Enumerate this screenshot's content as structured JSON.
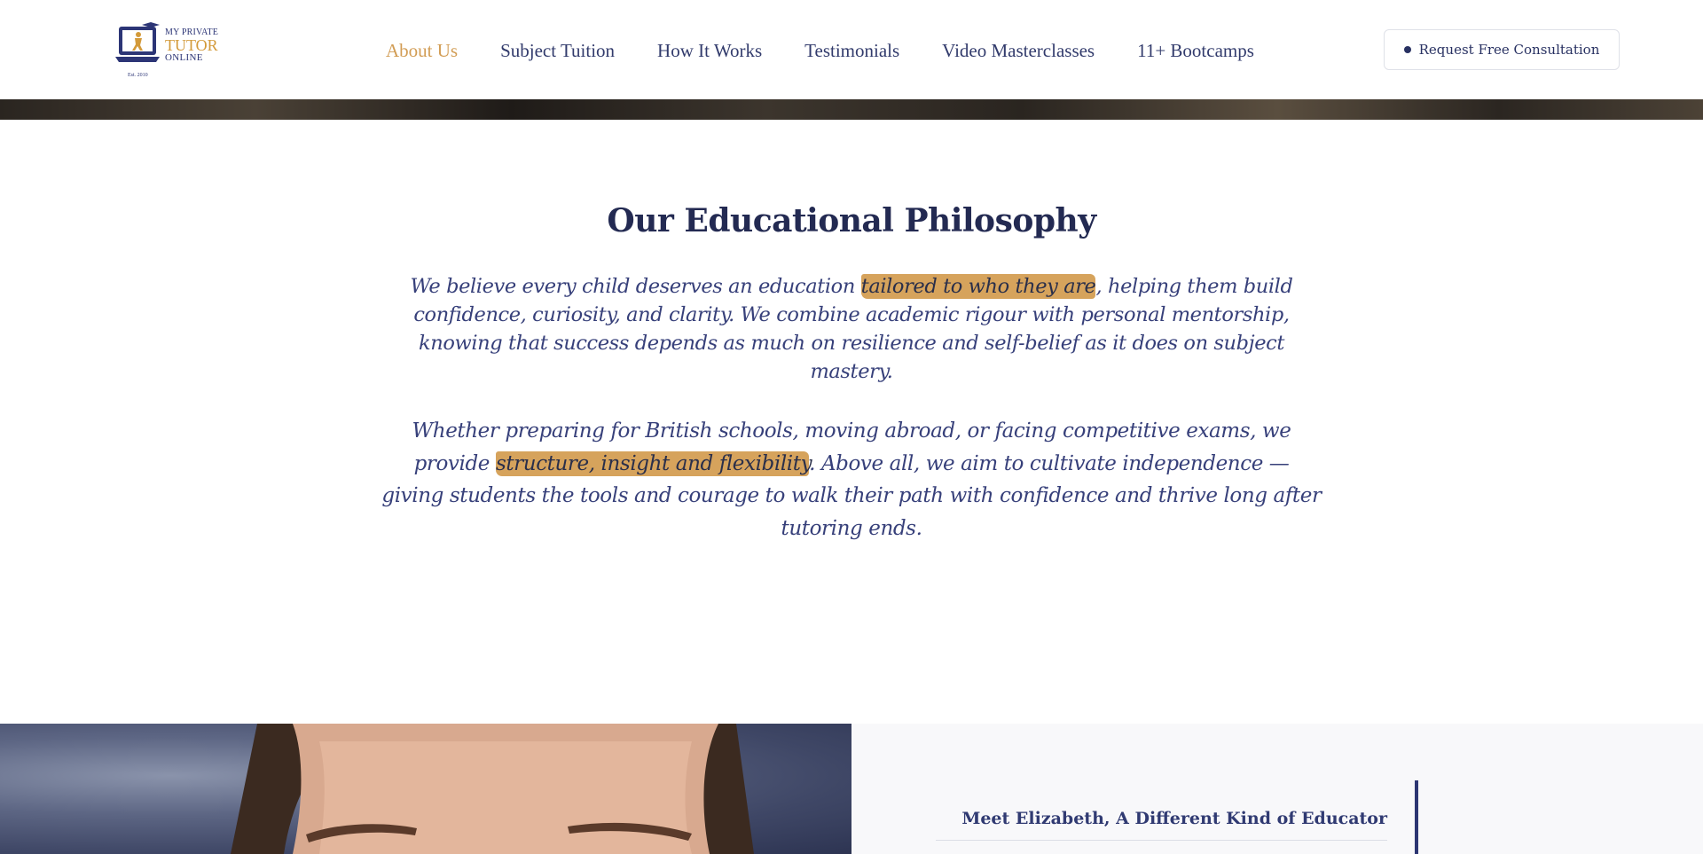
{
  "header": {
    "logo": {
      "line1": "MY PRIVATE",
      "line2": "TUTOR",
      "line3": "ONLINE",
      "est": "Est. 2010"
    },
    "nav": [
      {
        "label": "About Us",
        "active": true
      },
      {
        "label": "Subject Tuition",
        "active": false
      },
      {
        "label": "How It Works",
        "active": false
      },
      {
        "label": "Testimonials",
        "active": false
      },
      {
        "label": "Video Masterclasses",
        "active": false
      },
      {
        "label": "11+ Bootcamps",
        "active": false
      }
    ],
    "cta_label": "Request Free Consultation"
  },
  "philosophy": {
    "title": "Our Educational Philosophy",
    "p1": {
      "before": "We believe every child deserves an education ",
      "highlight": "tailored to who they are",
      "after": ", helping them build confidence, curiosity, and clarity. We combine academic rigour with personal mentorship, knowing that success depends as much on resilience and self-belief as it does on subject mastery."
    },
    "p2": {
      "before": "Whether preparing for British schools, moving abroad, or facing competitive exams, we provide ",
      "highlight": "structure, insight and flexibility",
      "after": ". Above all, we aim to cultivate independence — giving students the tools and courage to walk their path with confidence and thrive long after tutoring ends."
    }
  },
  "meet": {
    "title": "Meet Elizabeth, A Different Kind of Educator"
  },
  "colors": {
    "accent": "#d29d55",
    "highlight": "#d6a35c",
    "navy": "#283162"
  }
}
